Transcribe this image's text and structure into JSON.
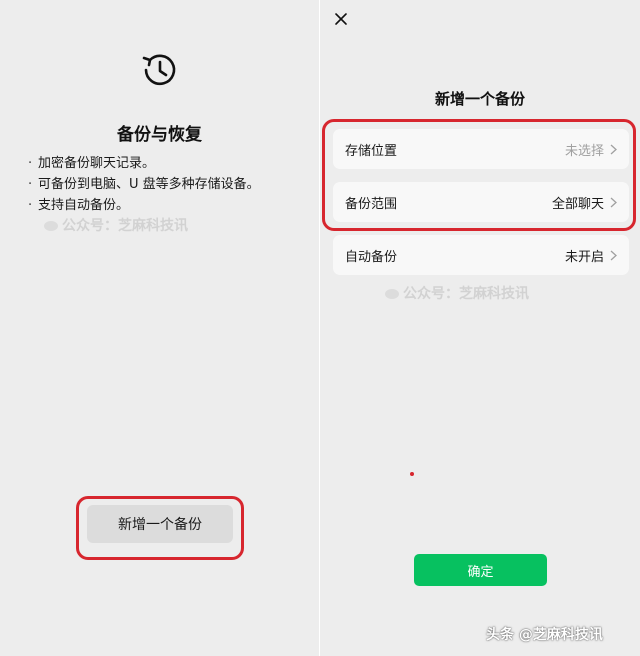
{
  "left": {
    "icon": "history-icon",
    "title": "备份与恢复",
    "bullets": [
      "加密备份聊天记录。",
      "可备份到电脑、U 盘等多种存储设备。",
      "支持自动备份。"
    ],
    "bullet_marker": "·",
    "watermark": "公众号：芝麻科技讯",
    "add_backup_label": "新增一个备份"
  },
  "right": {
    "close_icon": "close-icon",
    "title": "新增一个备份",
    "rows": [
      {
        "label": "存储位置",
        "value": "未选择"
      },
      {
        "label": "备份范围",
        "value": "全部聊天"
      },
      {
        "label": "自动备份",
        "value": "未开启"
      }
    ],
    "watermark": "公众号：芝麻科技讯",
    "confirm_label": "确定"
  },
  "footer": {
    "credit": "头条 @芝麻科技讯"
  },
  "colors": {
    "accent_green": "#07c160",
    "highlight_red": "#d7262e",
    "background": "#ededed",
    "card": "#f8f8f8",
    "muted_text": "#a0a0a0"
  }
}
